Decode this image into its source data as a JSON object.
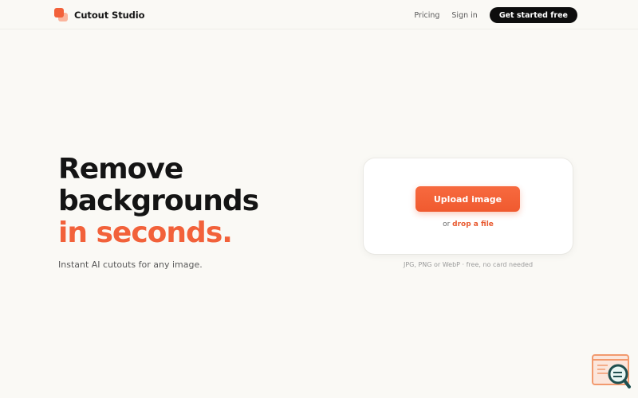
{
  "brand": {
    "name": "Cutout Studio",
    "logo_icon": "overlapping-squares-icon"
  },
  "nav": {
    "pricing": "Pricing",
    "sign_in": "Sign in",
    "cta": "Get started free"
  },
  "hero": {
    "title_line1": "Remove",
    "title_line2": "backgrounds",
    "title_line3": "in seconds.",
    "subtitle": "Instant AI cutouts for any image."
  },
  "upload": {
    "button_label": "Upload image",
    "drop_prefix": "or ",
    "drop_link": "drop a file",
    "note": "JPG, PNG or WebP · free, no card needed"
  },
  "widget": {
    "icon": "search-document-icon"
  },
  "colors": {
    "accent": "#f2613a",
    "background": "#faf9f5",
    "cta_bg": "#0d0d0d",
    "text": "#141414"
  }
}
